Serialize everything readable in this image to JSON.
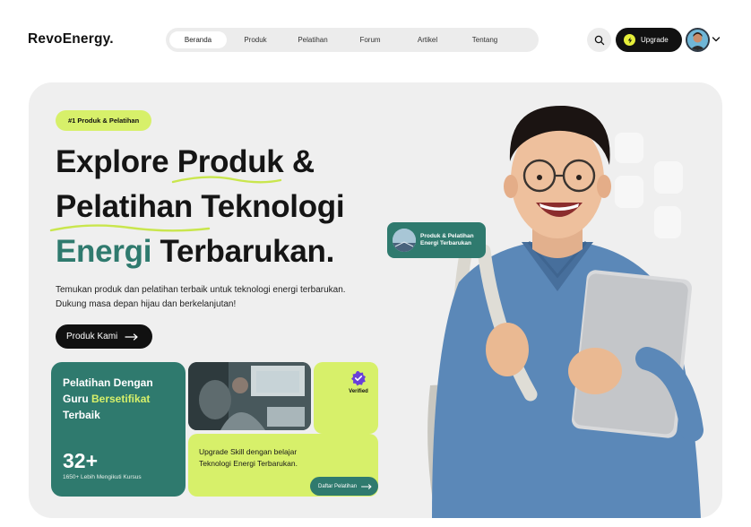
{
  "header": {
    "logo": "RevoEnergy.",
    "nav": [
      "Beranda",
      "Produk",
      "Pelatihan",
      "Forum",
      "Artikel",
      "Tentang"
    ],
    "active_nav": "Beranda",
    "upgrade_label": "Upgrade"
  },
  "hero": {
    "badge": "#1 Produk & Pelatihan",
    "headline": {
      "line1_a": "Explore ",
      "line1_b": "Produk",
      "line1_c": " &",
      "line2": "Pelatihan Teknologi",
      "line3_accent": "Energi",
      "line3_rest": " Terbarukan."
    },
    "description": "Temukan produk dan pelatihan terbaik untuk teknologi energi terbarukan. Dukung masa depan hijau dan berkelanjutan!",
    "cta_label": "Produk Kami",
    "float_card_label": "Produk & Pelatihan Energi Terbarukan"
  },
  "cards": {
    "teal": {
      "title_a": "Pelatihan Dengan",
      "title_b": "Guru ",
      "title_highlight": "Bersetifikat",
      "title_c": "Terbaik",
      "number": "32+",
      "subtitle": "1650+ Lebih Mengikuti Kursus"
    },
    "verified_label": "Verified",
    "lime_text": "Upgrade Skill  dengan belajar Teknologi Energi Terbarukan.",
    "daftar_label": "Daftar Pelatihan"
  },
  "colors": {
    "accent_teal": "#2f7a6e",
    "accent_lime": "#d7f06a",
    "dark": "#111111",
    "card_bg": "#efefef"
  },
  "icons": {
    "search": "search-icon",
    "bolt": "bolt-icon",
    "chevron": "chevron-down-icon",
    "arrow": "arrow-right-icon",
    "verified": "verified-badge-icon"
  }
}
